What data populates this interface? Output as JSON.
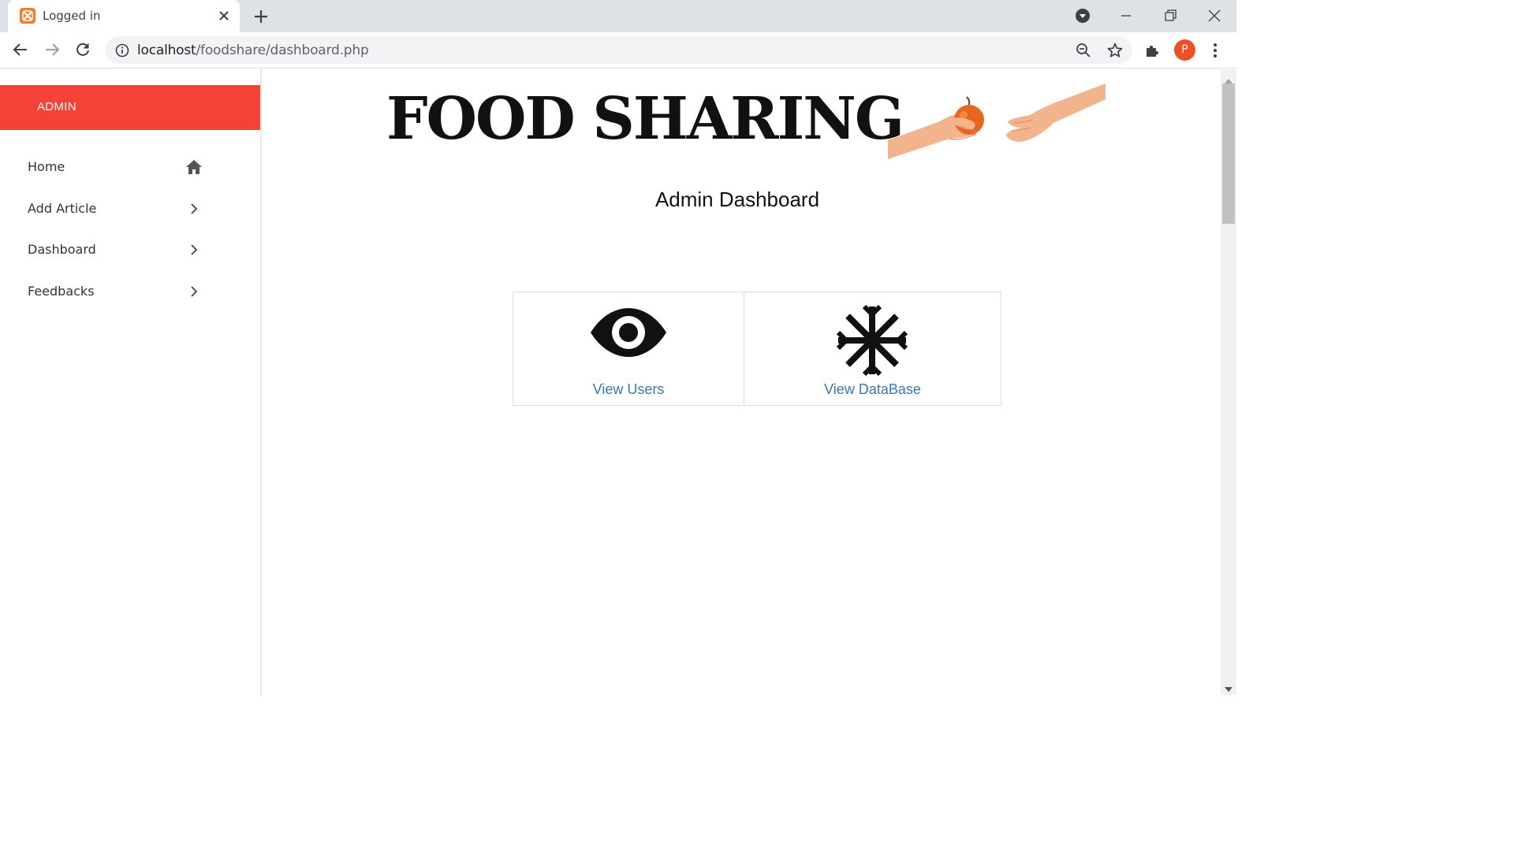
{
  "browser": {
    "tab_title": "Logged in",
    "url_host": "localhost",
    "url_path": "/foodshare/dashboard.php",
    "profile_initial": "P",
    "profile_color": "#f04e23"
  },
  "sidebar": {
    "header": "ADMIN",
    "header_color": "#f44336",
    "items": [
      {
        "label": "Home",
        "icon": "home-icon"
      },
      {
        "label": "Add Article",
        "icon": "chevron-right-icon"
      },
      {
        "label": "Dashboard",
        "icon": "chevron-right-icon"
      },
      {
        "label": "Feedbacks",
        "icon": "chevron-right-icon"
      }
    ]
  },
  "main": {
    "site_title": "FOOD SHARING",
    "page_title": "Admin Dashboard",
    "cards": [
      {
        "label": "View Users",
        "icon": "eye-icon"
      },
      {
        "label": "View DataBase",
        "icon": "asterisk-icon"
      }
    ],
    "link_color": "#337ab7"
  }
}
